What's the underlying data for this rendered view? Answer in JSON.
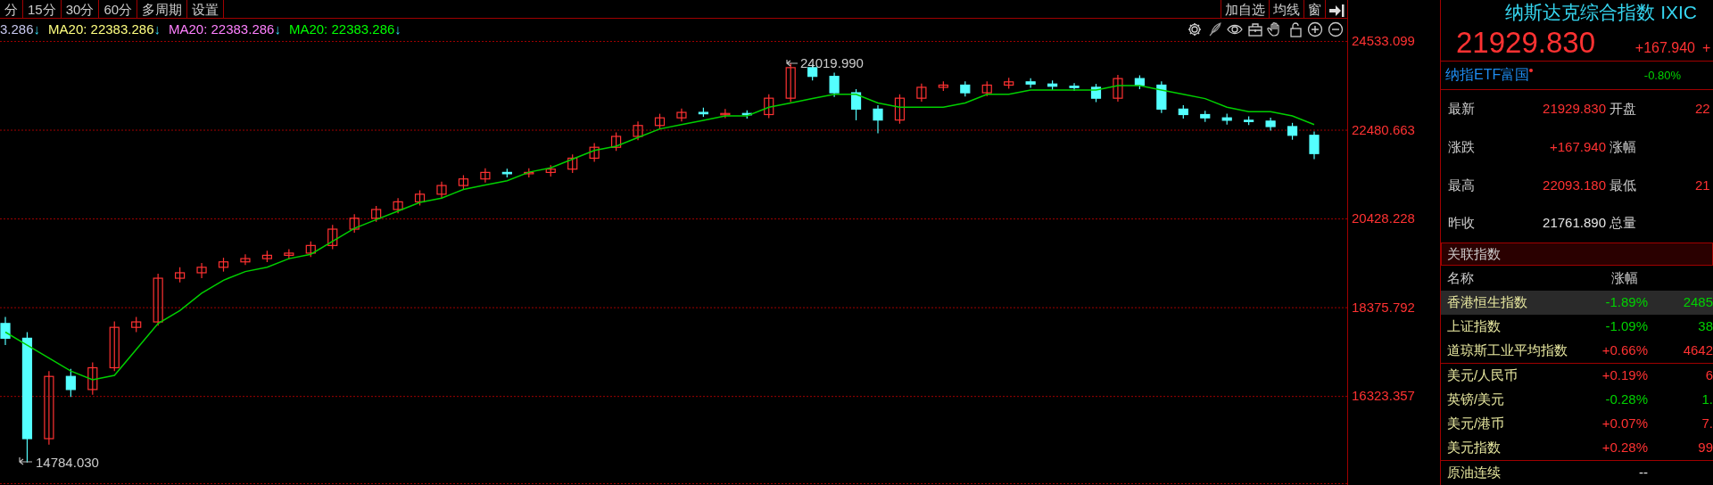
{
  "period_tabs": [
    {
      "label": "分"
    },
    {
      "label": "15分"
    },
    {
      "label": "30分"
    },
    {
      "label": "60分"
    },
    {
      "label": "多周期"
    },
    {
      "label": "设置"
    }
  ],
  "toolbar_buttons": [
    {
      "label": "加自选"
    },
    {
      "label": "均线"
    },
    {
      "label": "窗"
    }
  ],
  "ma_legend": [
    {
      "text": "3.286",
      "arrow": "↓",
      "color": "#c8c8f0"
    },
    {
      "text": "MA20: 22383.286",
      "arrow": "↓",
      "color": "#ffff80"
    },
    {
      "text": "MA20: 22383.286",
      "arrow": "↓",
      "color": "#ff80ff"
    },
    {
      "text": "MA20: 22383.286",
      "arrow": "↓",
      "color": "#00ff00"
    }
  ],
  "chart": {
    "high_label": "24019.990",
    "low_label": "14784.030",
    "chart_data": {
      "type": "candlestick",
      "ylim": [
        14265,
        24574
      ],
      "yticks": [
        {
          "value": 24533.099,
          "label": "24533.099"
        },
        {
          "value": 22480.663,
          "label": "22480.663"
        },
        {
          "value": 20428.228,
          "label": "20428.228"
        },
        {
          "value": 18375.792,
          "label": "18375.792"
        },
        {
          "value": 16323.357,
          "label": "16323.357"
        }
      ],
      "grid": true,
      "ohlc": [
        [
          18000,
          18150,
          17500,
          17659
        ],
        [
          17659,
          17800,
          14784.03,
          15337
        ],
        [
          15337,
          16900,
          15200,
          16776
        ],
        [
          16776,
          16950,
          16300,
          16473
        ],
        [
          16473,
          17100,
          16350,
          16977
        ],
        [
          16977,
          18050,
          16900,
          17911
        ],
        [
          17911,
          18150,
          17800,
          18037
        ],
        [
          18037,
          19150,
          17950,
          19047
        ],
        [
          19047,
          19300,
          18950,
          19173
        ],
        [
          19173,
          19400,
          19050,
          19300
        ],
        [
          19300,
          19520,
          19200,
          19425
        ],
        [
          19425,
          19600,
          19350,
          19501
        ],
        [
          19501,
          19680,
          19420,
          19577
        ],
        [
          19577,
          19720,
          19480,
          19627
        ],
        [
          19627,
          19900,
          19540,
          19804
        ],
        [
          19804,
          20280,
          19720,
          20182
        ],
        [
          20182,
          20530,
          20100,
          20434
        ],
        [
          20434,
          20720,
          20350,
          20636
        ],
        [
          20636,
          20900,
          20550,
          20814
        ],
        [
          20814,
          21080,
          20730,
          20990
        ],
        [
          20990,
          21280,
          20900,
          21191
        ],
        [
          21191,
          21430,
          21100,
          21343
        ],
        [
          21343,
          21590,
          21260,
          21494
        ],
        [
          21494,
          21580,
          21380,
          21469
        ],
        [
          21469,
          21590,
          21380,
          21494
        ],
        [
          21494,
          21660,
          21400,
          21570
        ],
        [
          21570,
          21910,
          21480,
          21823
        ],
        [
          21823,
          22170,
          21740,
          22075
        ],
        [
          22075,
          22420,
          21990,
          22327
        ],
        [
          22327,
          22670,
          22240,
          22579
        ],
        [
          22579,
          22850,
          22490,
          22756
        ],
        [
          22756,
          22970,
          22670,
          22882
        ],
        [
          22882,
          22990,
          22780,
          22850
        ],
        [
          22850,
          22960,
          22750,
          22857
        ],
        [
          22857,
          22930,
          22740,
          22832
        ],
        [
          22832,
          23300,
          22750,
          23210
        ],
        [
          23210,
          24019.99,
          23120,
          23917
        ],
        [
          23917,
          23990,
          23620,
          23715
        ],
        [
          23715,
          23800,
          23240,
          23336
        ],
        [
          23336,
          23420,
          22700,
          22958
        ],
        [
          22958,
          23050,
          22400,
          22705
        ],
        [
          22705,
          23300,
          22620,
          23210
        ],
        [
          23210,
          23550,
          23130,
          23462
        ],
        [
          23462,
          23600,
          23380,
          23513
        ],
        [
          23513,
          23600,
          23250,
          23336
        ],
        [
          23336,
          23600,
          23260,
          23513
        ],
        [
          23513,
          23680,
          23430,
          23588
        ],
        [
          23588,
          23670,
          23450,
          23538
        ],
        [
          23538,
          23620,
          23400,
          23487
        ],
        [
          23487,
          23560,
          23380,
          23462
        ],
        [
          23462,
          23540,
          23120,
          23210
        ],
        [
          23210,
          23750,
          23130,
          23664
        ],
        [
          23664,
          23740,
          23420,
          23513
        ],
        [
          23513,
          23600,
          22870,
          22958
        ],
        [
          22958,
          23050,
          22740,
          22832
        ],
        [
          22832,
          22920,
          22660,
          22756
        ],
        [
          22756,
          22850,
          22600,
          22700
        ],
        [
          22700,
          22790,
          22590,
          22680
        ],
        [
          22680,
          22760,
          22460,
          22554
        ],
        [
          22554,
          22640,
          22250,
          22352
        ],
        [
          22352,
          22440,
          21800,
          21930
        ]
      ],
      "series": [
        {
          "type": "line",
          "color": "#00d000",
          "values": [
            17800,
            17500,
            17200,
            16900,
            16700,
            16800,
            17400,
            18000,
            18300,
            18700,
            19000,
            19200,
            19300,
            19500,
            19600,
            19900,
            20200,
            20400,
            20600,
            20800,
            20900,
            21100,
            21200,
            21300,
            21500,
            21600,
            21800,
            22000,
            22100,
            22300,
            22500,
            22600,
            22700,
            22800,
            22800,
            23000,
            23100,
            23200,
            23300,
            23300,
            23100,
            23000,
            23000,
            23000,
            23100,
            23300,
            23300,
            23400,
            23400,
            23400,
            23400,
            23500,
            23500,
            23400,
            23300,
            23200,
            23000,
            22900,
            22900,
            22800,
            22600
          ]
        }
      ]
    }
  },
  "quote": {
    "title": "纳斯达克综合指数 IXIC",
    "price": "21929.830",
    "change": "+167.940",
    "change_pct": "+",
    "etf": {
      "name": "纳指ETF富国",
      "change": "-0.80%",
      "color": "#00d200"
    },
    "fields": [
      {
        "label": "最新",
        "value": "21929.830",
        "color": "#ff3232",
        "label2": "开盘",
        "value2": "22"
      },
      {
        "label": "涨跌",
        "value": "+167.940",
        "color": "#ff3232",
        "label2": "涨幅"
      },
      {
        "label": "最高",
        "value": "22093.180",
        "color": "#ff3232",
        "label2": "最低",
        "value2": "21"
      },
      {
        "label": "昨收",
        "value": "21761.890",
        "color": "#e6e6e6",
        "label2": "总量"
      }
    ]
  },
  "related": {
    "title": "关联指数",
    "columns": [
      "名称",
      "涨幅"
    ],
    "groups": [
      [
        {
          "name": "香港恒生指数",
          "change": "-1.89%",
          "price": "2485",
          "color": "#00d200",
          "selected": true
        },
        {
          "name": "上证指数",
          "change": "-1.09%",
          "price": "38",
          "color": "#00d200",
          "selected": false
        },
        {
          "name": "道琼斯工业平均指数",
          "change": "+0.66%",
          "price": "4642",
          "color": "#ff3232",
          "selected": false
        }
      ],
      [
        {
          "name": "美元/人民币",
          "change": "+0.19%",
          "price": "6",
          "color": "#ff3232",
          "selected": false
        },
        {
          "name": "英镑/美元",
          "change": "-0.28%",
          "price": "1.",
          "color": "#00d200",
          "selected": false
        },
        {
          "name": "美元/港币",
          "change": "+0.07%",
          "price": "7.",
          "color": "#ff3232",
          "selected": false
        },
        {
          "name": "美元指数",
          "change": "+0.28%",
          "price": "99",
          "color": "#ff3232",
          "selected": false
        }
      ],
      [
        {
          "name": "原油连续",
          "change": "--",
          "color": "#e6e6e6",
          "selected": false
        }
      ]
    ]
  }
}
